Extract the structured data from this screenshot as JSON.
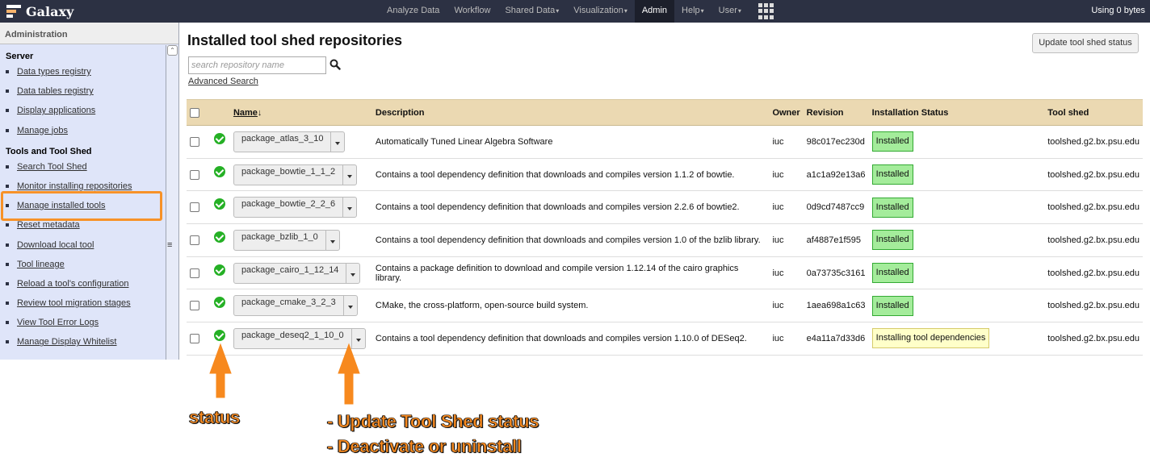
{
  "masthead": {
    "brand": "Galaxy",
    "nav": [
      {
        "label": "Analyze Data",
        "dropdown": false
      },
      {
        "label": "Workflow",
        "dropdown": false
      },
      {
        "label": "Shared Data",
        "dropdown": true
      },
      {
        "label": "Visualization",
        "dropdown": true
      },
      {
        "label": "Admin",
        "dropdown": false,
        "active": true
      },
      {
        "label": "Help",
        "dropdown": true
      },
      {
        "label": "User",
        "dropdown": true
      }
    ],
    "quota": "Using 0 bytes"
  },
  "left_panel": {
    "title": "Administration",
    "sections": [
      {
        "title": "Server",
        "links": [
          "Data types registry",
          "Data tables registry",
          "Display applications",
          "Manage jobs"
        ]
      },
      {
        "title": "Tools and Tool Shed",
        "links": [
          "Search Tool Shed",
          "Monitor installing repositories",
          "Manage installed tools",
          "Reset metadata",
          "Download local tool",
          "Tool lineage",
          "Reload a tool's configuration",
          "Review tool migration stages",
          "View Tool Error Logs",
          "Manage Display Whitelist"
        ]
      }
    ]
  },
  "main": {
    "title": "Installed tool shed repositories",
    "update_button": "Update tool shed status",
    "search_placeholder": "search repository name",
    "advanced_search": "Advanced Search",
    "columns": [
      "Name",
      "Description",
      "Owner",
      "Revision",
      "Installation Status",
      "Tool shed"
    ],
    "sort_indicator": "↓",
    "rows": [
      {
        "name": "package_atlas_3_10",
        "description": "Automatically Tuned Linear Algebra Software",
        "owner": "iuc",
        "revision": "98c017ec230d",
        "status": "Installed",
        "toolshed": "toolshed.g2.bx.psu.edu"
      },
      {
        "name": "package_bowtie_1_1_2",
        "description": "Contains a tool dependency definition that downloads and compiles version 1.1.2 of bowtie.",
        "owner": "iuc",
        "revision": "a1c1a92e13a6",
        "status": "Installed",
        "toolshed": "toolshed.g2.bx.psu.edu"
      },
      {
        "name": "package_bowtie_2_2_6",
        "description": "Contains a tool dependency definition that downloads and compiles version 2.2.6 of bowtie2.",
        "owner": "iuc",
        "revision": "0d9cd7487cc9",
        "status": "Installed",
        "toolshed": "toolshed.g2.bx.psu.edu"
      },
      {
        "name": "package_bzlib_1_0",
        "description": "Contains a tool dependency definition that downloads and compiles version 1.0 of the bzlib library.",
        "owner": "iuc",
        "revision": "af4887e1f595",
        "status": "Installed",
        "toolshed": "toolshed.g2.bx.psu.edu"
      },
      {
        "name": "package_cairo_1_12_14",
        "description": "Contains a package definition to download and compile version 1.12.14 of the cairo graphics library.",
        "owner": "iuc",
        "revision": "0a73735c3161",
        "status": "Installed",
        "toolshed": "toolshed.g2.bx.psu.edu"
      },
      {
        "name": "package_cmake_3_2_3",
        "description": "CMake, the cross-platform, open-source build system.",
        "owner": "iuc",
        "revision": "1aea698a1c63",
        "status": "Installed",
        "toolshed": "toolshed.g2.bx.psu.edu"
      },
      {
        "name": "package_deseq2_1_10_0",
        "description": "Contains a tool dependency definition that downloads and compiles version 1.10.0 of DESeq2.",
        "owner": "iuc",
        "revision": "e4a11a7d33d6",
        "status": "Installing tool dependencies",
        "toolshed": "toolshed.g2.bx.psu.edu"
      }
    ]
  },
  "annotations": {
    "status_label": "status",
    "actions_line1": "- Update Tool Shed status",
    "actions_line2": "- Deactivate or uninstall",
    "accent": "#f79228"
  }
}
